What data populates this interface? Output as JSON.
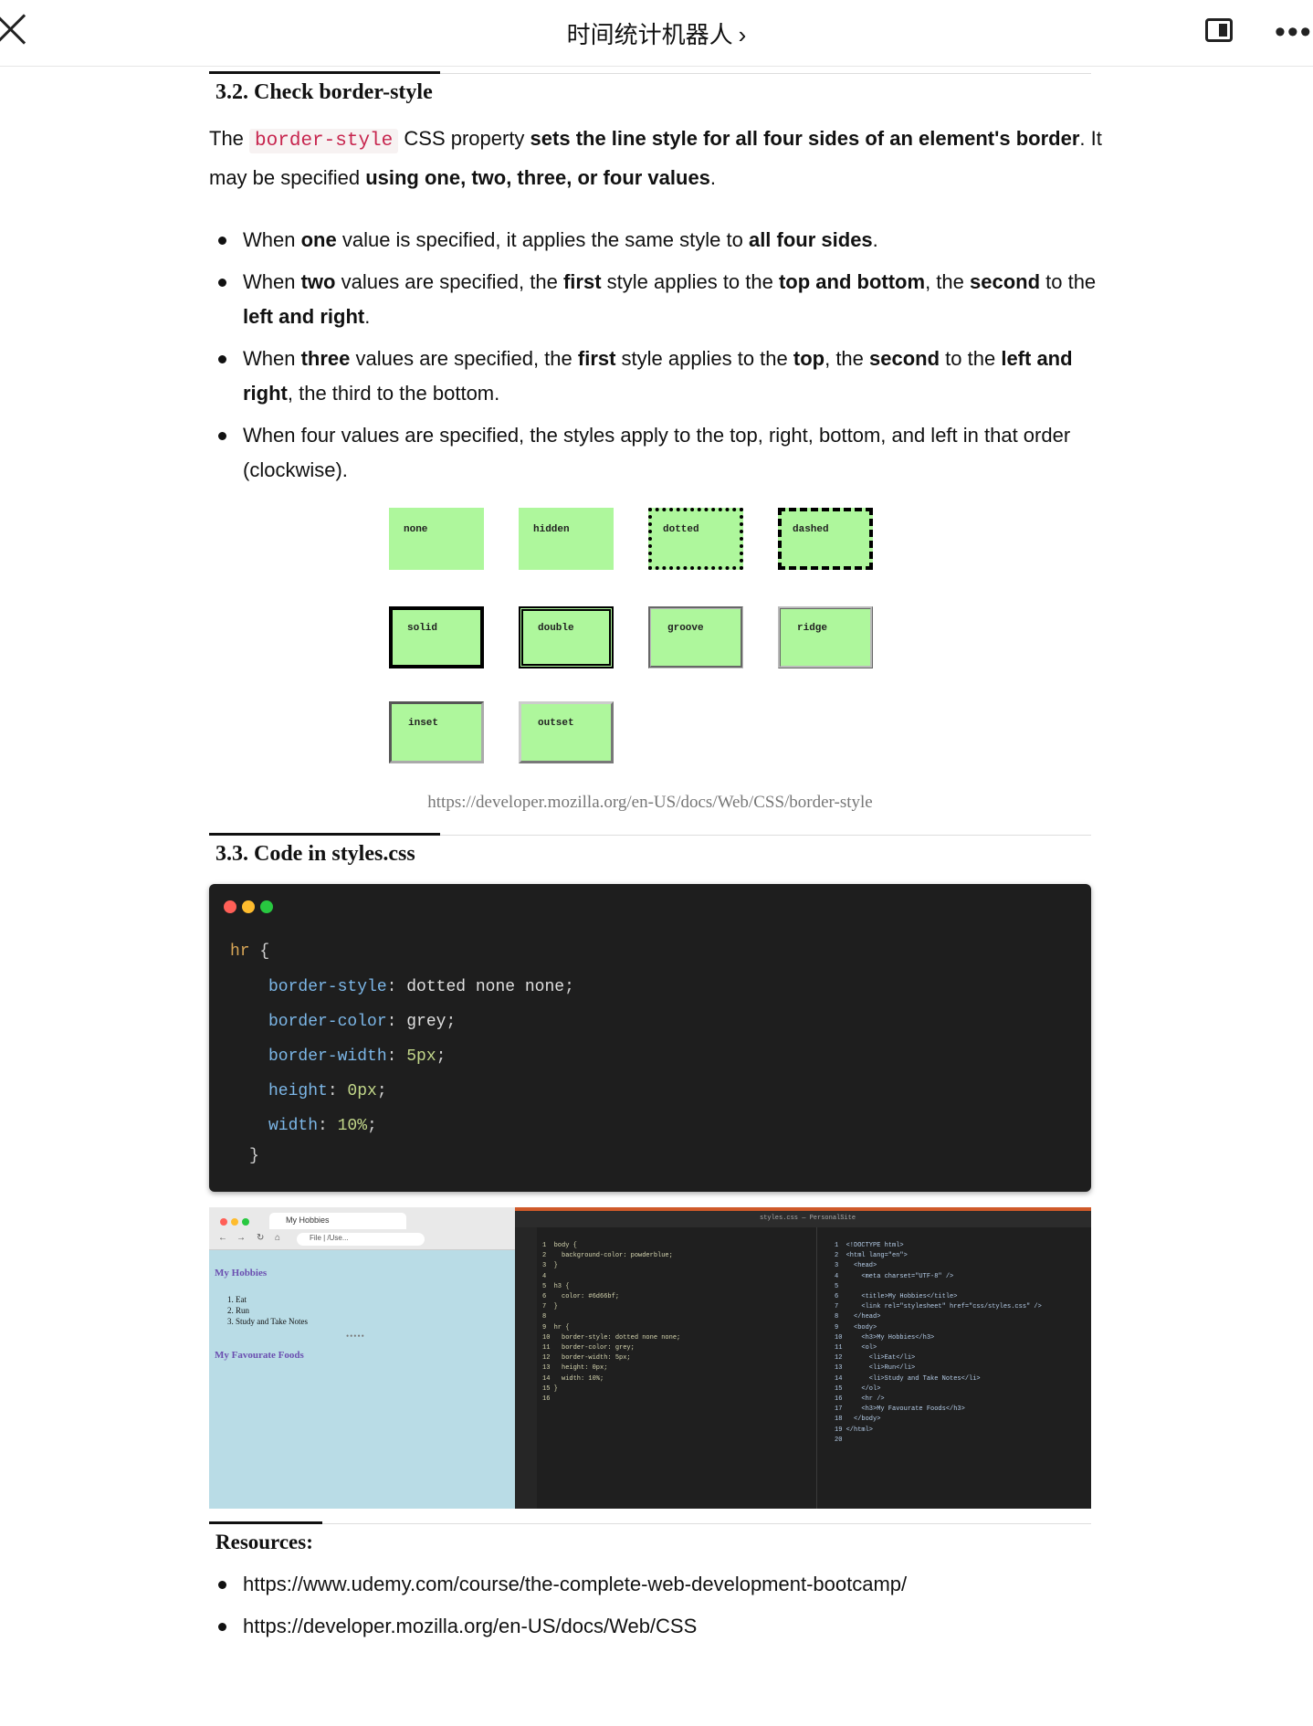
{
  "topbar": {
    "title": "时间统计机器人",
    "chevron": "›",
    "more": "•••"
  },
  "section_32": {
    "heading": "3.2. Check border-style",
    "intro": {
      "t1": "The ",
      "code": "border-style",
      "t2": " CSS property ",
      "b1": "sets the line style for all four sides of an element's border",
      "t3": ". It may be specified ",
      "b2": "using one, two, three, or four values",
      "t4": "."
    },
    "bullets": [
      {
        "p1": "When ",
        "b1": "one",
        "p2": " value is specified, it applies the same style to ",
        "b2": "all four sides",
        "p3": "."
      },
      {
        "p1": "When ",
        "b1": "two",
        "p2": " values are specified, the ",
        "b2": "first",
        "p3": " style applies to the ",
        "b3": "top and bottom",
        "p4": ", the ",
        "b4": "second",
        "p5": " to the ",
        "b5": "left and right",
        "p6": "."
      },
      {
        "p1": "When ",
        "b1": "three",
        "p2": " values are specified, the ",
        "b2": "first",
        "p3": " style applies to the ",
        "b3": "top",
        "p4": ", the ",
        "b4": "second",
        "p5": " to the ",
        "b5": "left and right",
        "p6": ", the third to the bottom."
      },
      {
        "p1": "When four values are specified, the styles apply to the top, right, bottom, and left in that order (clockwise)."
      }
    ],
    "demo_boxes": [
      "none",
      "hidden",
      "dotted",
      "dashed",
      "solid",
      "double",
      "groove",
      "ridge",
      "inset",
      "outset"
    ],
    "source_url": "https://developer.mozilla.org/en-US/docs/Web/CSS/border-style"
  },
  "section_33": {
    "heading": "3.3. Code in styles.css",
    "code": {
      "selector": "hr",
      "open": " {",
      "close": "}",
      "lines": [
        {
          "prop": "border-style",
          "val": " dotted none none",
          "num": ""
        },
        {
          "prop": "border-color",
          "val": " grey",
          "num": ""
        },
        {
          "prop": "border-width",
          "val": "",
          "num": " 5px"
        },
        {
          "prop": "height",
          "val": "",
          "num": " 0px"
        },
        {
          "prop": "width",
          "val": "",
          "num": " 10%"
        }
      ]
    },
    "screenshot": {
      "browser_tab": "My Hobbies",
      "address": "File | /Use...",
      "heading1": "My Hobbies",
      "list": [
        "1. Eat",
        "2. Run",
        "3. Study and Take Notes"
      ],
      "divider": "•••••",
      "heading2": "My Favourate Foods",
      "editor_title": "styles.css — PersonalSite",
      "css_lines": [
        "1  body {",
        "2    background-color: powderblue;",
        "3  }",
        "4",
        "5  h3 {",
        "6    color: #6d66bf;",
        "7  }",
        "8",
        "9  hr {",
        "10   border-style: dotted none none;",
        "11   border-color: grey;",
        "12   border-width: 5px;",
        "13   height: 0px;",
        "14   width: 10%;",
        "15 }",
        "16"
      ],
      "html_lines": [
        "1  <!DOCTYPE html>",
        "2  <html lang=\"en\">",
        "3    <head>",
        "4      <meta charset=\"UTF-8\" />",
        "5",
        "6      <title>My Hobbies</title>",
        "7      <link rel=\"stylesheet\" href=\"css/styles.css\" />",
        "8    </head>",
        "9    <body>",
        "10     <h3>My Hobbies</h3>",
        "11     <ol>",
        "12       <li>Eat</li>",
        "13       <li>Run</li>",
        "14       <li>Study and Take Notes</li>",
        "15     </ol>",
        "16     <hr />",
        "17     <h3>My Favourate Foods</h3>",
        "18   </body>",
        "19 </html>",
        "20"
      ]
    }
  },
  "resources": {
    "title": "Resources:",
    "links": [
      "https://www.udemy.com/course/the-complete-web-development-bootcamp/",
      "https://developer.mozilla.org/en-US/docs/Web/CSS"
    ]
  },
  "colors": {
    "demo_green": "#aef79c",
    "code_bg": "#1e1e1e",
    "inline_code": "#c7254e",
    "browser_bg": "#b9dce6",
    "heading_purple": "#6b4fb0"
  }
}
